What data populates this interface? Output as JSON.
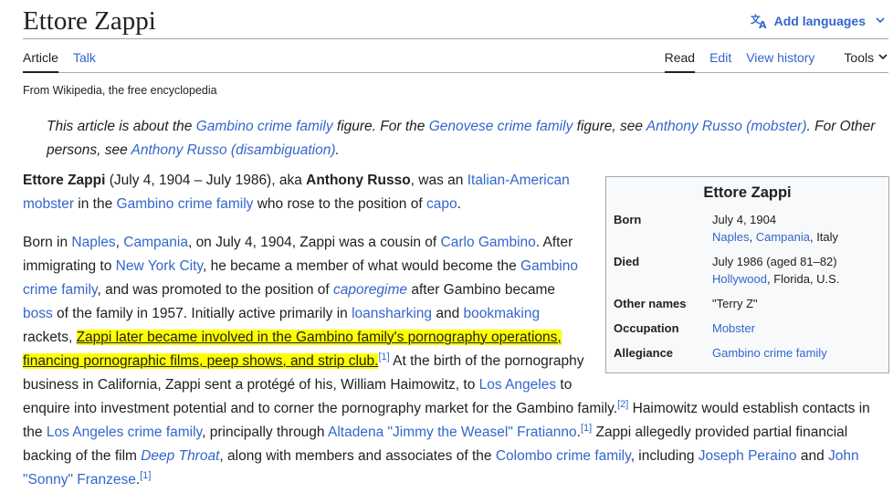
{
  "header": {
    "title": "Ettore Zappi",
    "add_languages": "Add languages",
    "tabs_left": [
      {
        "label": "Article"
      },
      {
        "label": "Talk"
      }
    ],
    "tabs_right": [
      {
        "label": "Read"
      },
      {
        "label": "Edit"
      },
      {
        "label": "View history"
      }
    ],
    "tools": "Tools"
  },
  "tagline": "From Wikipedia, the free encyclopedia",
  "hatnote": {
    "t1": "This article is about the ",
    "l1": "Gambino crime family",
    "t2": " figure. For the ",
    "l2": "Genovese crime family",
    "t3": " figure, see ",
    "l3": "Anthony Russo (mobster)",
    "t4": ". For Other persons, see ",
    "l4": "Anthony Russo (disambiguation)",
    "t5": "."
  },
  "infobox": {
    "title": "Ettore Zappi",
    "rows": [
      {
        "label": "Born",
        "line1": "July 4, 1904",
        "link1": "Naples",
        "sep1": ", ",
        "link2": "Campania",
        "text2": ", Italy"
      },
      {
        "label": "Died",
        "line1": "July 1986 (aged 81–82)",
        "link1": "Hollywood",
        "text1": ", Florida, U.S."
      },
      {
        "label": "Other names",
        "value": "\"Terry Z\""
      },
      {
        "label": "Occupation",
        "link": "Mobster"
      },
      {
        "label": "Allegiance",
        "link": "Gambino crime family"
      }
    ]
  },
  "para1": {
    "b1": "Ettore Zappi",
    "t1": " (July 4, 1904 – July 1986), aka ",
    "b2": "Anthony Russo",
    "t2": ", was an ",
    "l1": "Italian-American",
    "t3": " ",
    "l2": "mobster",
    "t4": " in the ",
    "l3": "Gambino crime family",
    "t5": " who rose to the position of ",
    "l4": "capo",
    "t6": "."
  },
  "para2": {
    "t1": "Born in ",
    "l1": "Naples",
    "t2": ", ",
    "l2": "Campania",
    "t3": ", on July 4, 1904, Zappi was a cousin of ",
    "l3": "Carlo Gambino",
    "t4": ". After immigrating to ",
    "l4": "New York City",
    "t5": ", he became a member of what would become the ",
    "l5": "Gambino crime family",
    "t6": ", and was promoted to the position of ",
    "l6": "caporegime",
    "t7": " after Gambino became ",
    "l7": "boss",
    "t8": " of the family in 1957. Initially active primarily in ",
    "l8": "loansharking",
    "t9": " and ",
    "l9": "bookmaking",
    "t10": " rackets, ",
    "hl": "Zappi later became involved in the Gambino family's pornography operations, financing pornographic films, peep shows, and strip club.",
    "ref1": "[1]",
    "t11": " At the birth of the pornography business in California, Zappi sent a protégé of his, William Haimowitz, to ",
    "l10": "Los Angeles",
    "t12": " to enquire into investment potential and to corner the pornography market for the Gambino family.",
    "ref2": "[2]",
    "t13": " Haimowitz would establish contacts in the ",
    "l11": "Los Angeles crime family",
    "t14": ", principally through ",
    "l12": "Altadena \"Jimmy the Weasel\" Fratianno",
    "t15": ".",
    "ref3": "[1]",
    "t16": " Zappi allegedly provided partial financial backing of the film ",
    "l13": "Deep Throat",
    "t17": ", along with members and associates of the ",
    "l14": "Colombo crime family",
    "t18": ", including ",
    "l15": "Joseph Peraino",
    "t19": " and ",
    "l16": "John \"Sonny\" Franzese",
    "t20": ".",
    "ref4": "[1]"
  }
}
